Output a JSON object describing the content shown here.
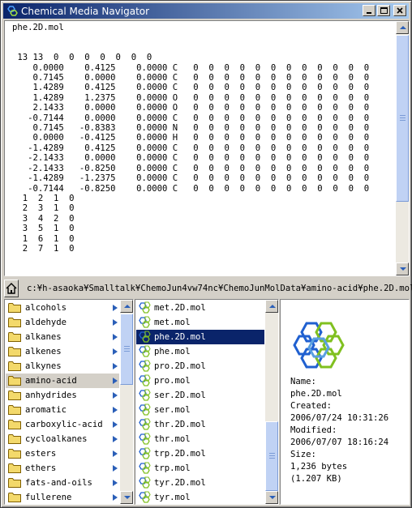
{
  "window": {
    "title": "Chemical Media Navigator"
  },
  "editor": {
    "content": "phe.2D.mol\n\n\n 13 13  0  0  0  0  0  0  0\n    0.0000    0.4125    0.0000 C   0  0  0  0  0  0  0  0  0  0  0  0\n    0.7145    0.0000    0.0000 C   0  0  0  0  0  0  0  0  0  0  0  0\n    1.4289    0.4125    0.0000 C   0  0  0  0  0  0  0  0  0  0  0  0\n    1.4289    1.2375    0.0000 O   0  0  0  0  0  0  0  0  0  0  0  0\n    2.1433    0.0000    0.0000 O   0  0  0  0  0  0  0  0  0  0  0  0\n   -0.7144    0.0000    0.0000 C   0  0  0  0  0  0  0  0  0  0  0  0\n    0.7145   -0.8383    0.0000 N   0  0  0  0  0  0  0  0  0  0  0  0\n    0.0000   -0.4125    0.0000 H   0  0  0  0  0  0  0  0  0  0  0  0\n   -1.4289    0.4125    0.0000 C   0  0  0  0  0  0  0  0  0  0  0  0\n   -2.1433    0.0000    0.0000 C   0  0  0  0  0  0  0  0  0  0  0  0\n   -2.1433   -0.8250    0.0000 C   0  0  0  0  0  0  0  0  0  0  0  0\n   -1.4289   -1.2375    0.0000 C   0  0  0  0  0  0  0  0  0  0  0  0\n   -0.7144   -0.8250    0.0000 C   0  0  0  0  0  0  0  0  0  0  0  0\n  1  2  1  0\n  2  3  1  0\n  3  4  2  0\n  3  5  1  0\n  1  6  1  0\n  2  7  1  0"
  },
  "path": {
    "text": "c:¥h-asaoka¥Smalltalk¥ChemoJun4vw74nc¥ChemoJunMolData¥amino-acid¥phe.2D.mol"
  },
  "folders": [
    {
      "label": "alcohols",
      "selected": false
    },
    {
      "label": "aldehyde",
      "selected": false
    },
    {
      "label": "alkanes",
      "selected": false
    },
    {
      "label": "alkenes",
      "selected": false
    },
    {
      "label": "alkynes",
      "selected": false
    },
    {
      "label": "amino-acid",
      "selected": true
    },
    {
      "label": "anhydrides",
      "selected": false
    },
    {
      "label": "aromatic",
      "selected": false
    },
    {
      "label": "carboxylic-acid",
      "selected": false
    },
    {
      "label": "cycloalkanes",
      "selected": false
    },
    {
      "label": "esters",
      "selected": false
    },
    {
      "label": "ethers",
      "selected": false
    },
    {
      "label": "fats-and-oils",
      "selected": false
    },
    {
      "label": "fullerene",
      "selected": false
    }
  ],
  "files": [
    {
      "label": "met.2D.mol",
      "selected": false
    },
    {
      "label": "met.mol",
      "selected": false
    },
    {
      "label": "phe.2D.mol",
      "selected": true
    },
    {
      "label": "phe.mol",
      "selected": false
    },
    {
      "label": "pro.2D.mol",
      "selected": false
    },
    {
      "label": "pro.mol",
      "selected": false
    },
    {
      "label": "ser.2D.mol",
      "selected": false
    },
    {
      "label": "ser.mol",
      "selected": false
    },
    {
      "label": "thr.2D.mol",
      "selected": false
    },
    {
      "label": "thr.mol",
      "selected": false
    },
    {
      "label": "trp.2D.mol",
      "selected": false
    },
    {
      "label": "trp.mol",
      "selected": false
    },
    {
      "label": "tyr.2D.mol",
      "selected": false
    },
    {
      "label": "tyr.mol",
      "selected": false
    }
  ],
  "info": {
    "name_label": "Name:",
    "name_value": "phe.2D.mol",
    "created_label": "Created:",
    "created_value": "2006/07/24 10:31:26",
    "modified_label": "Modified:",
    "modified_value": "2006/07/07 18:16:24",
    "size_label": "Size:",
    "size_bytes": "1,236 bytes",
    "size_kb": "(1.207 KB)"
  },
  "colors": {
    "selection": "#0a246a",
    "scroll_accent": "#2b5fb8",
    "folder": "#f3d96b",
    "logo_blue": "#2060d0",
    "logo_green": "#80c020"
  }
}
